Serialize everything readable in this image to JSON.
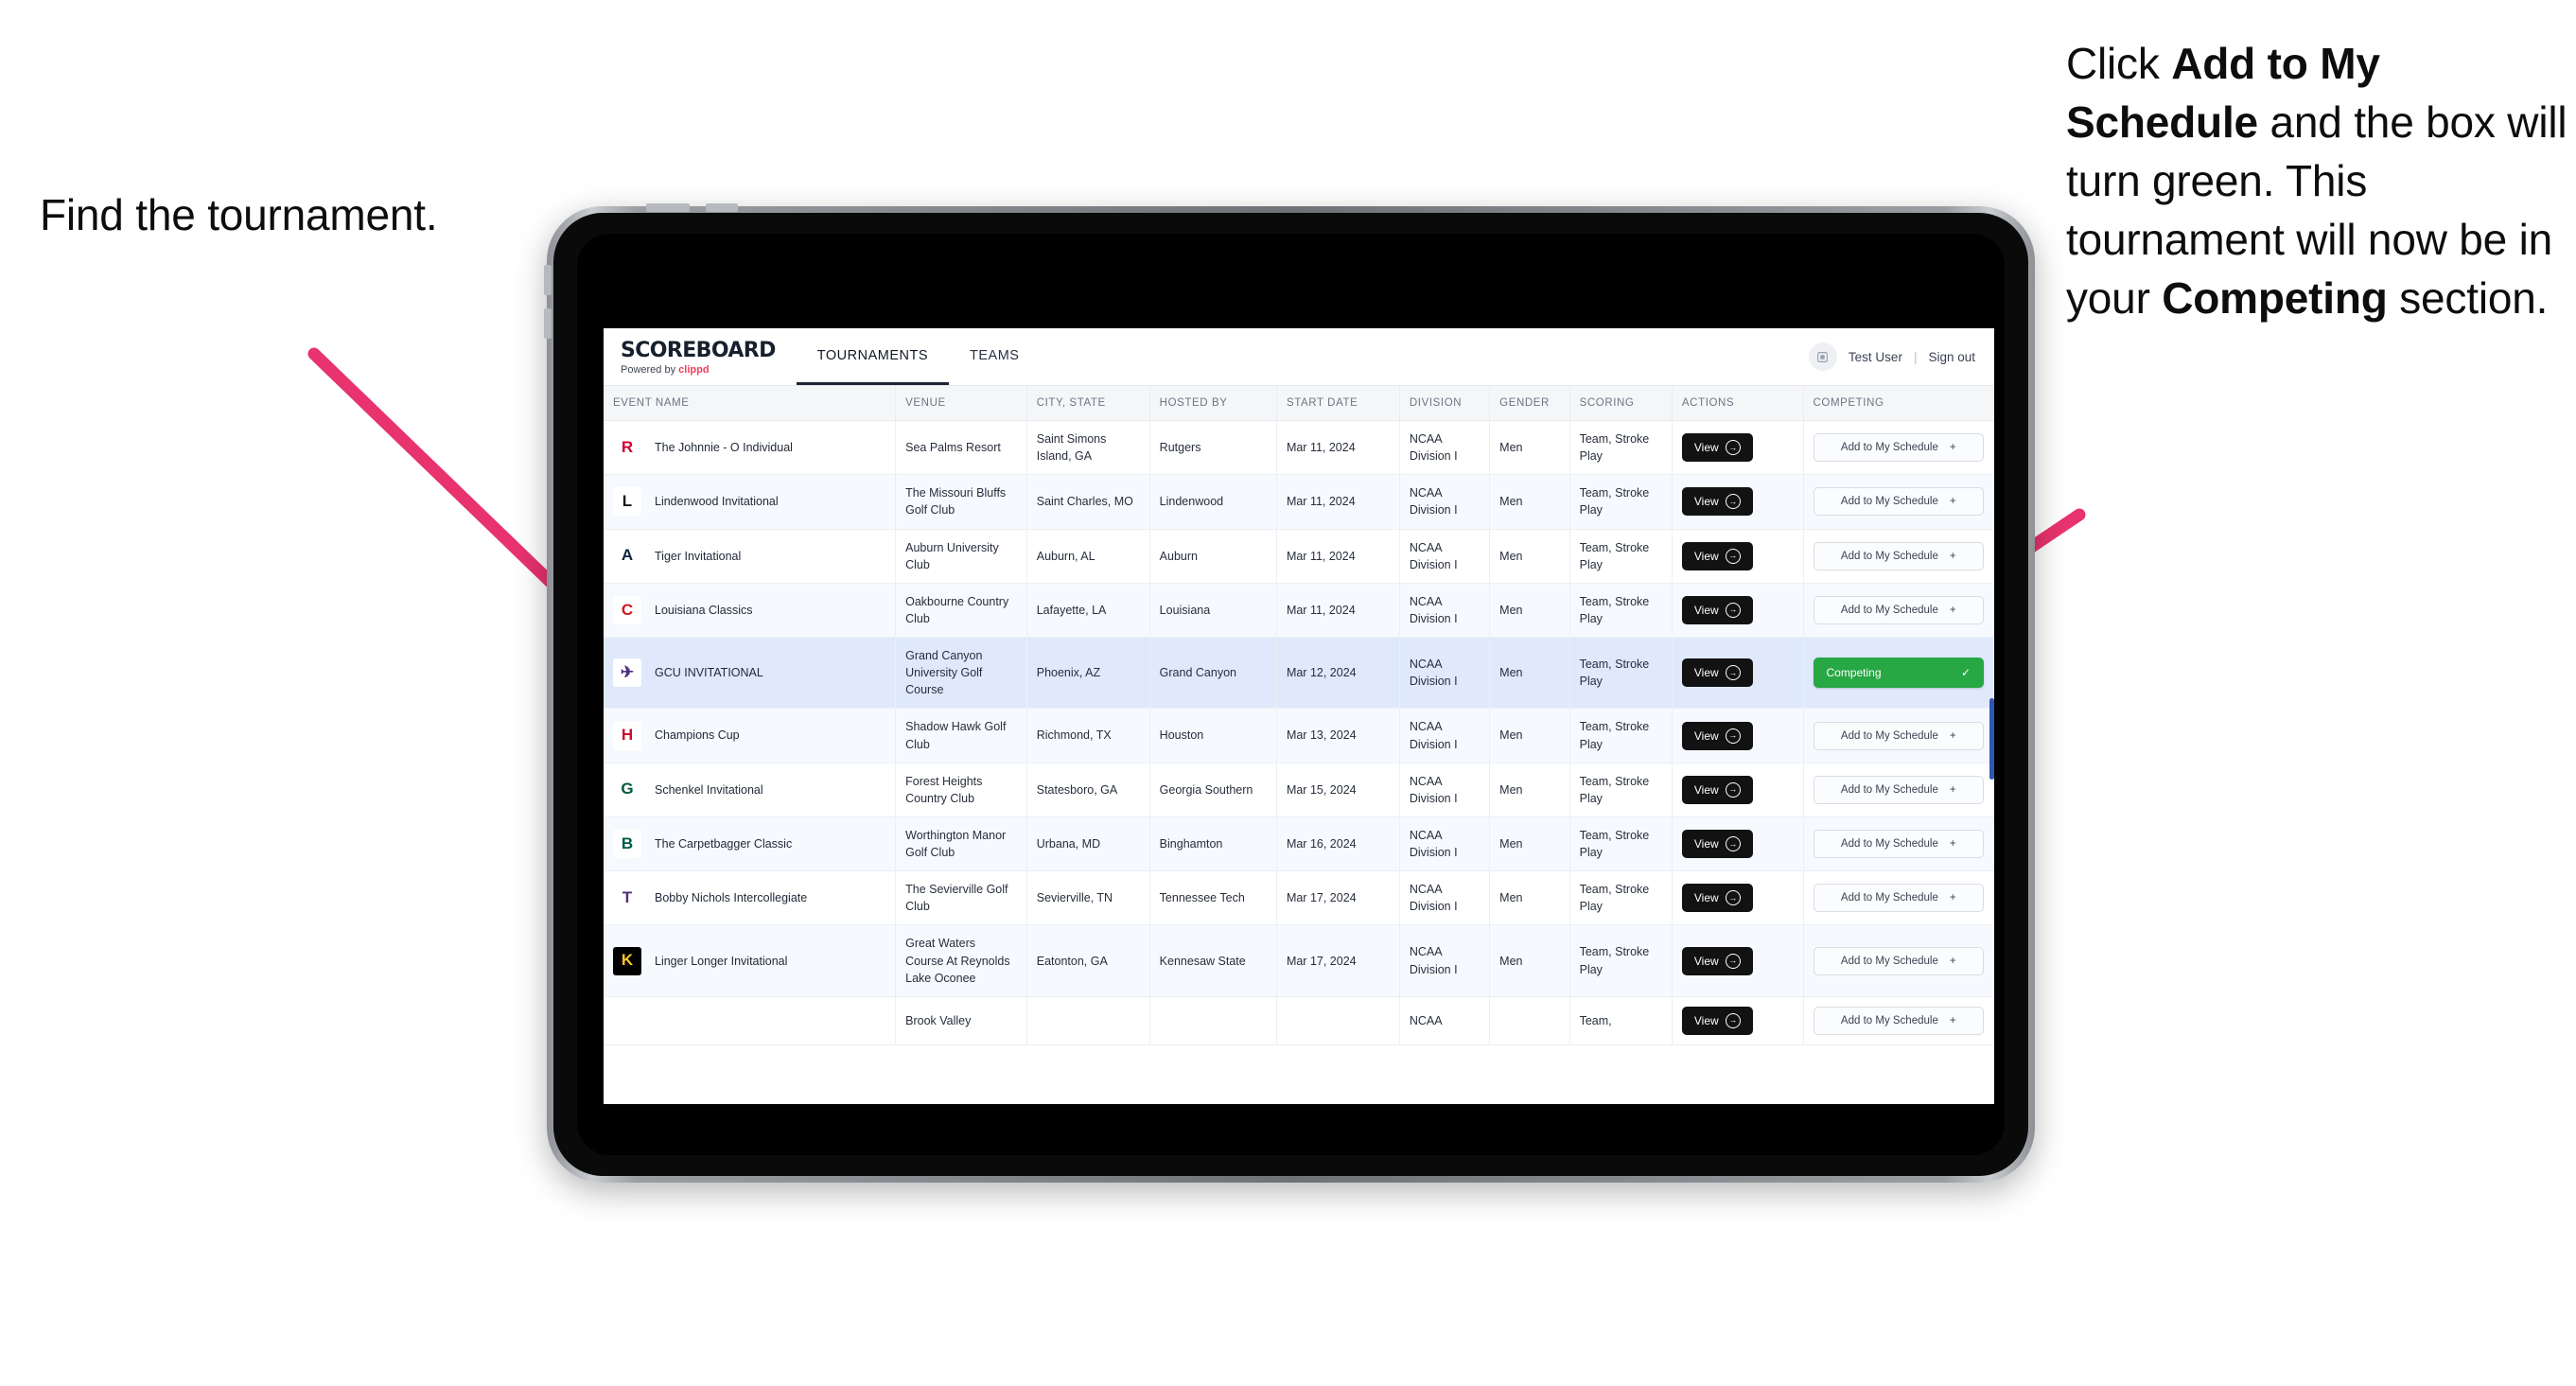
{
  "annotations": {
    "left": "Find the tournament.",
    "right_parts": [
      {
        "text": "Click ",
        "bold": false
      },
      {
        "text": "Add to My Schedule",
        "bold": true
      },
      {
        "text": " and the box will turn green. This tournament will now be in your ",
        "bold": false
      },
      {
        "text": "Competing",
        "bold": true
      },
      {
        "text": " section.",
        "bold": false
      }
    ],
    "arrow_color": "#e8336e"
  },
  "app": {
    "brand": {
      "title": "SCOREBOARD",
      "powered_prefix": "Powered by ",
      "powered_name": "clippd"
    },
    "tabs": [
      {
        "label": "TOURNAMENTS",
        "active": true
      },
      {
        "label": "TEAMS",
        "active": false
      }
    ],
    "user": {
      "avatar_icon": "user-avatar-icon",
      "name": "Test User",
      "separator": "|",
      "signout": "Sign out"
    },
    "table": {
      "columns": [
        "EVENT NAME",
        "VENUE",
        "CITY, STATE",
        "HOSTED BY",
        "START DATE",
        "DIVISION",
        "GENDER",
        "SCORING",
        "ACTIONS",
        "COMPETING"
      ],
      "view_label": "View",
      "view_icon": "circle-arrow-right-icon",
      "add_label": "Add to My Schedule",
      "add_icon": "plus-icon",
      "competing_label": "Competing",
      "competing_icon": "check-icon",
      "competing_color": "#28a745",
      "rows": [
        {
          "event": "The Johnnie - O Individual",
          "logo": {
            "text": "R",
            "color": "#cc0033",
            "bg": "#ffffff"
          },
          "venue": "Sea Palms Resort",
          "city": "Saint Simons Island, GA",
          "host": "Rutgers",
          "date": "Mar 11, 2024",
          "division": "NCAA Division I",
          "gender": "Men",
          "scoring": "Team, Stroke Play",
          "competing": false
        },
        {
          "event": "Lindenwood Invitational",
          "logo": {
            "text": "L",
            "color": "#1a1a1a",
            "bg": "#ffffff"
          },
          "venue": "The Missouri Bluffs Golf Club",
          "city": "Saint Charles, MO",
          "host": "Lindenwood",
          "date": "Mar 11, 2024",
          "division": "NCAA Division I",
          "gender": "Men",
          "scoring": "Team, Stroke Play",
          "competing": false
        },
        {
          "event": "Tiger Invitational",
          "logo": {
            "text": "A",
            "color": "#0c2340",
            "bg": "#ffffff"
          },
          "venue": "Auburn University Club",
          "city": "Auburn, AL",
          "host": "Auburn",
          "date": "Mar 11, 2024",
          "division": "NCAA Division I",
          "gender": "Men",
          "scoring": "Team, Stroke Play",
          "competing": false
        },
        {
          "event": "Louisiana Classics",
          "logo": {
            "text": "C",
            "color": "#ce181e",
            "bg": "#ffffff"
          },
          "venue": "Oakbourne Country Club",
          "city": "Lafayette, LA",
          "host": "Louisiana",
          "date": "Mar 11, 2024",
          "division": "NCAA Division I",
          "gender": "Men",
          "scoring": "Team, Stroke Play",
          "competing": false
        },
        {
          "event": "GCU INVITATIONAL",
          "logo": {
            "text": "✈",
            "color": "#4b2e83",
            "bg": "#ffffff"
          },
          "venue": "Grand Canyon University Golf Course",
          "city": "Phoenix, AZ",
          "host": "Grand Canyon",
          "date": "Mar 12, 2024",
          "division": "NCAA Division I",
          "gender": "Men",
          "scoring": "Team, Stroke Play",
          "competing": true,
          "selected": true
        },
        {
          "event": "Champions Cup",
          "logo": {
            "text": "H",
            "color": "#c8102e",
            "bg": "#ffffff"
          },
          "venue": "Shadow Hawk Golf Club",
          "city": "Richmond, TX",
          "host": "Houston",
          "date": "Mar 13, 2024",
          "division": "NCAA Division I",
          "gender": "Men",
          "scoring": "Team, Stroke Play",
          "competing": false
        },
        {
          "event": "Schenkel Invitational",
          "logo": {
            "text": "G",
            "color": "#00573f",
            "bg": "#ffffff"
          },
          "venue": "Forest Heights Country Club",
          "city": "Statesboro, GA",
          "host": "Georgia Southern",
          "date": "Mar 15, 2024",
          "division": "NCAA Division I",
          "gender": "Men",
          "scoring": "Team, Stroke Play",
          "competing": false
        },
        {
          "event": "The Carpetbagger Classic",
          "logo": {
            "text": "B",
            "color": "#005a43",
            "bg": "#ffffff"
          },
          "venue": "Worthington Manor Golf Club",
          "city": "Urbana, MD",
          "host": "Binghamton",
          "date": "Mar 16, 2024",
          "division": "NCAA Division I",
          "gender": "Men",
          "scoring": "Team, Stroke Play",
          "competing": false
        },
        {
          "event": "Bobby Nichols Intercollegiate",
          "logo": {
            "text": "T",
            "color": "#52307c",
            "bg": "#ffffff"
          },
          "venue": "The Sevierville Golf Club",
          "city": "Sevierville, TN",
          "host": "Tennessee Tech",
          "date": "Mar 17, 2024",
          "division": "NCAA Division I",
          "gender": "Men",
          "scoring": "Team, Stroke Play",
          "competing": false
        },
        {
          "event": "Linger Longer Invitational",
          "logo": {
            "text": "K",
            "color": "#ffc629",
            "bg": "#000000"
          },
          "venue": "Great Waters Course At Reynolds Lake Oconee",
          "city": "Eatonton, GA",
          "host": "Kennesaw State",
          "date": "Mar 17, 2024",
          "division": "NCAA Division I",
          "gender": "Men",
          "scoring": "Team, Stroke Play",
          "competing": false
        },
        {
          "event": "",
          "logo": {
            "text": "",
            "color": "#7b2d8b",
            "bg": "#ffffff"
          },
          "venue": "Brook Valley",
          "city": "",
          "host": "",
          "date": "",
          "division": "NCAA",
          "gender": "",
          "scoring": "Team,",
          "competing": false,
          "clipped": true
        }
      ]
    }
  }
}
